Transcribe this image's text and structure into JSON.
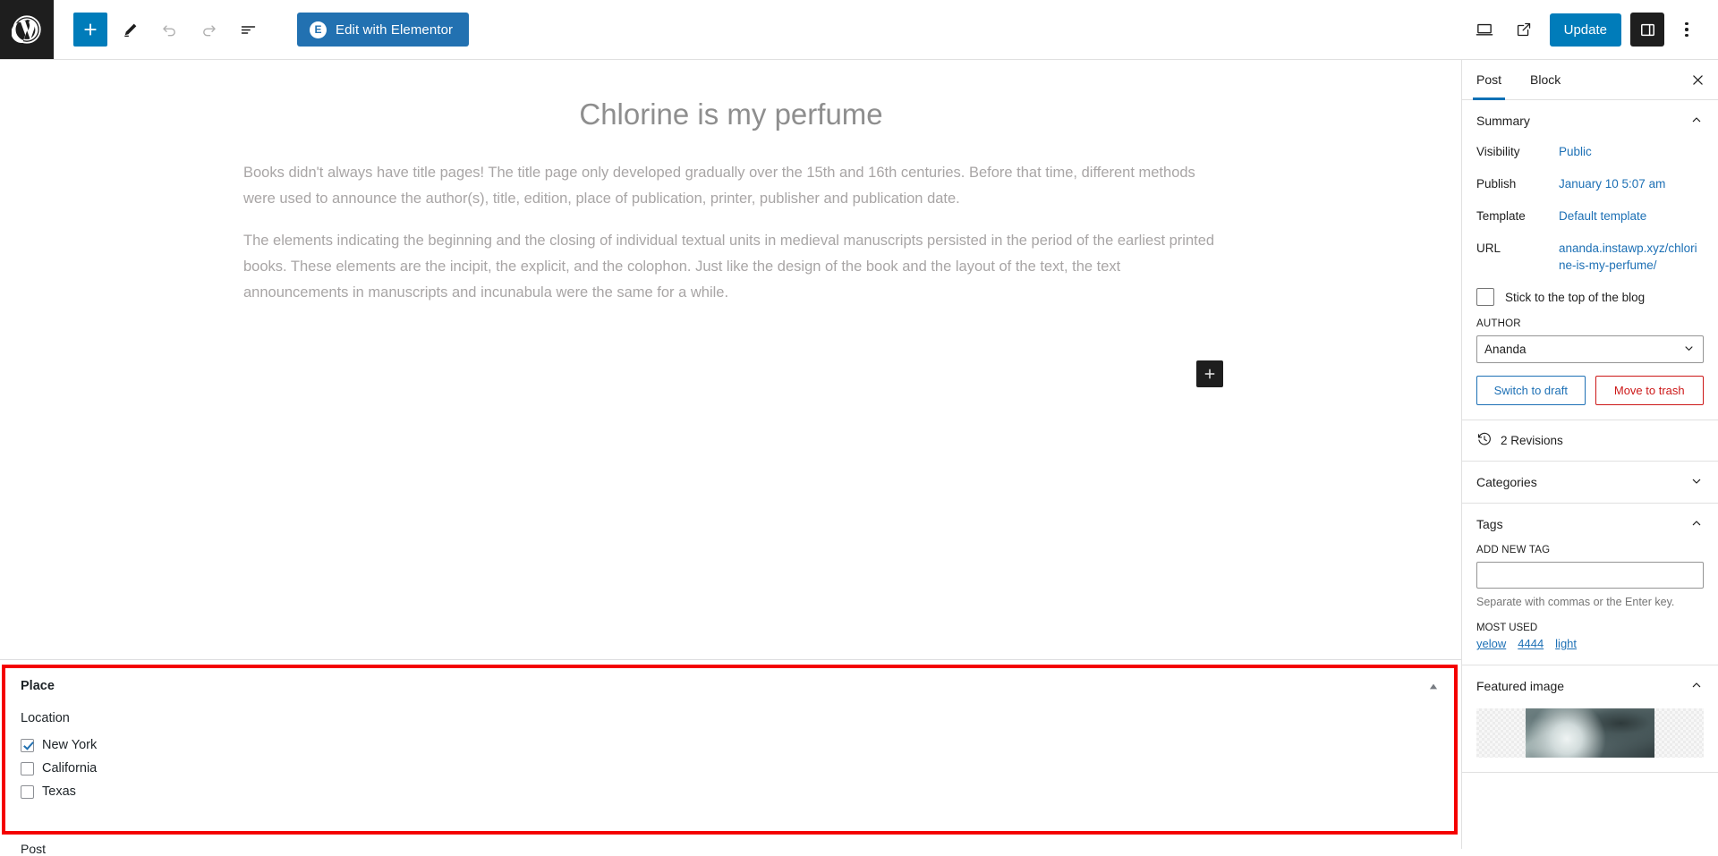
{
  "topbar": {
    "logo_icon": "wordpress-logo-icon",
    "tools": [
      {
        "name": "block-inserter-toggle",
        "icon": "plus-icon",
        "label": "Toggle block inserter",
        "state": "primary"
      },
      {
        "name": "tools-pencil",
        "icon": "pencil-icon",
        "label": "Tools",
        "state": "normal"
      },
      {
        "name": "undo",
        "icon": "undo-arrow-icon",
        "label": "Undo",
        "state": "disabled"
      },
      {
        "name": "redo",
        "icon": "redo-arrow-icon",
        "label": "Redo",
        "state": "disabled"
      },
      {
        "name": "document-overview",
        "icon": "list-view-icon",
        "label": "Document Overview",
        "state": "normal"
      }
    ],
    "elementor_label": "Edit with Elementor",
    "elementor_badge": "E",
    "view_icon": "desktop-monitor-icon",
    "preview_icon": "external-link-icon",
    "update_label": "Update",
    "settings_icon": "sidebar-panel-icon",
    "options_icon": "vertical-ellipsis-icon"
  },
  "editor": {
    "title": "Chlorine is my perfume",
    "paragraphs": [
      "Books didn't always have title pages! The title page only developed gradually over the 15th and 16th centuries. Before that time, different methods were used to announce the author(s), title, edition, place of publication, printer, publisher and publication date.",
      "The elements indicating the beginning and the closing of individual textual units in medieval manuscripts persisted in the period of the earliest printed books. These elements are the incipit, the explicit, and the colophon. Just like the design of the book and the layout of the text, the text announcements in manuscripts and incunabula were the same for a while."
    ],
    "inserter_icon": "plus-icon"
  },
  "metabox": {
    "title": "Place",
    "toggle_icon": "triangle-up-icon",
    "field_label": "Location",
    "options": [
      {
        "label": "New York",
        "checked": true
      },
      {
        "label": "California",
        "checked": false
      },
      {
        "label": "Texas",
        "checked": false
      }
    ],
    "below_label": "Post",
    "highlight_color": "#f40000"
  },
  "sidebar": {
    "tabs": [
      {
        "label": "Post",
        "active": true
      },
      {
        "label": "Block",
        "active": false
      }
    ],
    "close_icon": "close-x-icon",
    "summary": {
      "title": "Summary",
      "chevron": "chevron-up-icon",
      "rows": [
        {
          "key": "Visibility",
          "value": "Public"
        },
        {
          "key": "Publish",
          "value": "January 10 5:07 am"
        },
        {
          "key": "Template",
          "value": "Default template"
        },
        {
          "key": "URL",
          "value": "ananda.instawp.xyz/chlorine-is-my-perfume/"
        }
      ],
      "sticky_label": "Stick to the top of the blog",
      "sticky_checked": false,
      "author_label": "AUTHOR",
      "author_value": "Ananda",
      "author_chevron": "chevron-down-icon",
      "switch_draft_label": "Switch to draft",
      "move_trash_label": "Move to trash"
    },
    "revisions": {
      "icon": "clock-history-icon",
      "label": "2 Revisions"
    },
    "categories": {
      "title": "Categories",
      "chevron": "chevron-down-icon"
    },
    "tags": {
      "title": "Tags",
      "chevron": "chevron-up-icon",
      "add_label": "ADD NEW TAG",
      "input_value": "",
      "helper": "Separate with commas or the Enter key.",
      "most_used_label": "MOST USED",
      "most_used": [
        "yelow",
        "4444",
        "light"
      ]
    },
    "featured_image": {
      "title": "Featured image",
      "chevron": "chevron-up-icon"
    }
  },
  "colors": {
    "accent": "#007cba",
    "link": "#1d70b5",
    "danger": "#cc1818",
    "dark": "#1e1e1e"
  }
}
